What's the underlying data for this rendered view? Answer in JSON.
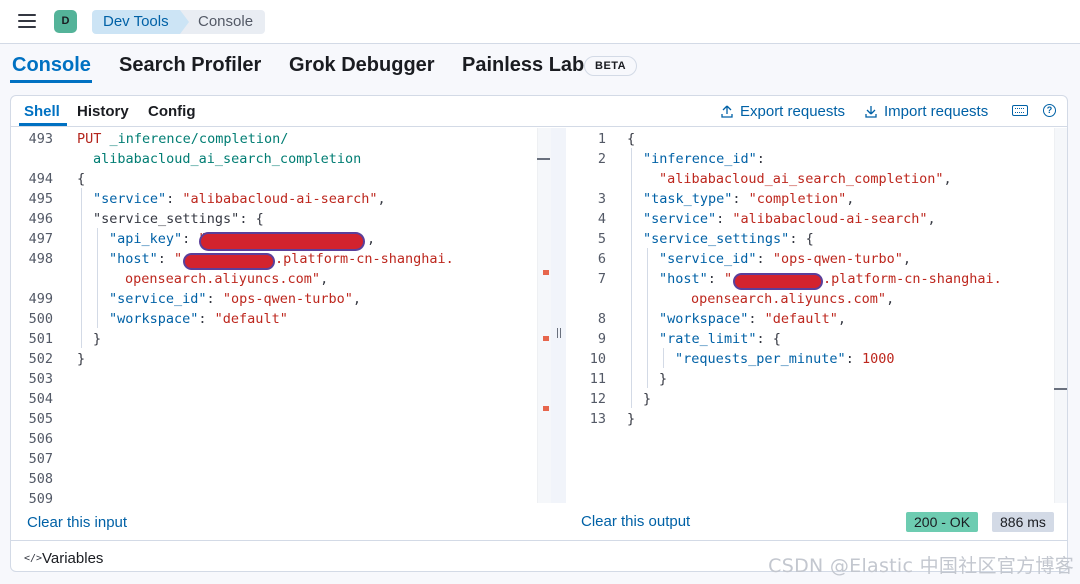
{
  "header": {
    "avatar_letter": "D",
    "breadcrumb": [
      "Dev Tools",
      "Console"
    ]
  },
  "app_tabs": [
    {
      "label": "Console",
      "active": true
    },
    {
      "label": "Search Profiler"
    },
    {
      "label": "Grok Debugger"
    },
    {
      "label": "Painless Lab"
    }
  ],
  "beta_badge": "BETA",
  "sub_tabs": [
    {
      "label": "Shell",
      "active": true
    },
    {
      "label": "History"
    },
    {
      "label": "Config"
    }
  ],
  "actions": {
    "export": "Export requests",
    "import": "Import requests"
  },
  "request_editor": {
    "line_numbers": [
      "493",
      "494",
      "495",
      "496",
      "497",
      "498",
      "499",
      "500",
      "501",
      "502",
      "503",
      "504",
      "505",
      "506",
      "507",
      "508",
      "509"
    ],
    "method": "PUT",
    "path_1": "_inference/completion/",
    "path_2": "alibabacloud_ai_search_completion",
    "brace_open": "{",
    "brace_close": "}",
    "k_service": "\"service\"",
    "v_service": "\"alibabacloud-ai-search\"",
    "k_service_settings": "\"service_settings\"",
    "k_api_key": "\"api_key\"",
    "v_api_key_open": "\"",
    "k_host": "\"host\"",
    "v_host_open": "\"",
    "v_host_mid": ".platform-cn-shanghai.",
    "v_host_end": "opensearch.aliyuncs.com\"",
    "k_service_id": "\"service_id\"",
    "v_service_id": "\"ops-qwen-turbo\"",
    "k_workspace": "\"workspace\"",
    "v_workspace": "\"default\""
  },
  "response_editor": {
    "line_numbers": [
      "1",
      "2",
      "3",
      "4",
      "5",
      "6",
      "7",
      "8",
      "9",
      "10",
      "11",
      "12",
      "13"
    ],
    "k_inference_id": "\"inference_id\"",
    "v_inference_id": "\"alibabacloud_ai_search_completion\"",
    "k_task_type": "\"task_type\"",
    "v_task_type": "\"completion\"",
    "k_service": "\"service\"",
    "v_service": "\"alibabacloud-ai-search\"",
    "k_service_settings": "\"service_settings\"",
    "k_service_id": "\"service_id\"",
    "v_service_id": "\"ops-qwen-turbo\"",
    "k_host": "\"host\"",
    "v_host_open": "\"",
    "v_host_mid": ".platform-cn-shanghai.",
    "v_host_end": "opensearch.aliyuncs.com\"",
    "k_workspace": "\"workspace\"",
    "v_workspace": "\"default\"",
    "k_rate_limit": "\"rate_limit\"",
    "k_rpm": "\"requests_per_minute\"",
    "v_rpm": "1000"
  },
  "footer": {
    "clear_input": "Clear this input",
    "clear_output": "Clear this output",
    "status": "200 - OK",
    "duration": "886 ms"
  },
  "variables_label": "Variables",
  "watermark": "CSDN @Elastic 中国社区官方博客",
  "colors": {
    "accent": "#0071c2",
    "link": "#0061a6",
    "string": "#bd271e",
    "status_ok": "#6dccb1",
    "redaction": "#d3232e"
  }
}
